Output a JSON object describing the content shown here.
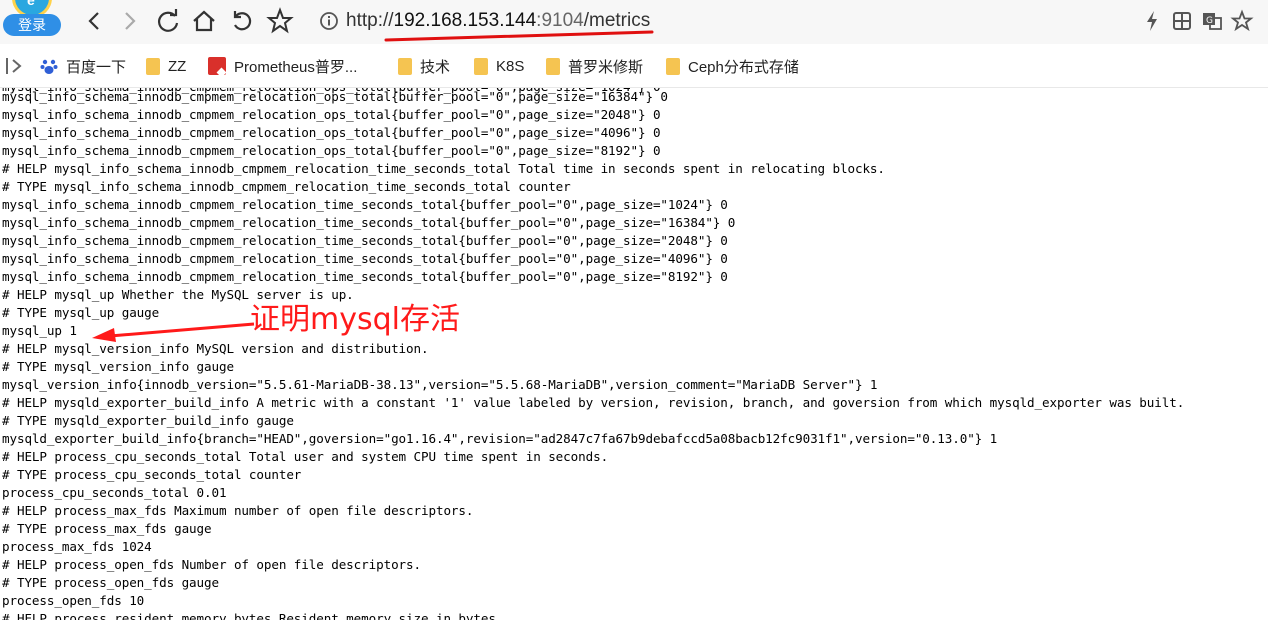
{
  "toolbar": {
    "login_label": "登录",
    "url": {
      "protocol": "http://",
      "host": "192.168.153.144",
      "port": ":9104",
      "path": "/metrics"
    },
    "icons": [
      "back-icon",
      "forward-icon",
      "reload-icon",
      "home-icon",
      "undo-icon",
      "star-icon",
      "info-icon",
      "lightning-icon",
      "grid-icon",
      "translate-icon",
      "favorite-star-icon"
    ]
  },
  "bookmarks": [
    {
      "label": "百度一下",
      "icon": "baidu-paw-icon"
    },
    {
      "label": "ZZ",
      "icon": "folder-icon"
    },
    {
      "label": "Prometheus普罗...",
      "icon": "pdf-icon"
    },
    {
      "label": "技术",
      "icon": "folder-icon"
    },
    {
      "label": "K8S",
      "icon": "folder-icon"
    },
    {
      "label": "普罗米修斯",
      "icon": "folder-icon"
    },
    {
      "label": "Ceph分布式存储",
      "icon": "folder-icon"
    }
  ],
  "content": {
    "lines": [
      "mysql_info_schema_innodb_cmpmem_relocation_ops_total{buffer_pool=\"0\",page_size=\"16384\"} 0",
      "mysql_info_schema_innodb_cmpmem_relocation_ops_total{buffer_pool=\"0\",page_size=\"2048\"} 0",
      "mysql_info_schema_innodb_cmpmem_relocation_ops_total{buffer_pool=\"0\",page_size=\"4096\"} 0",
      "mysql_info_schema_innodb_cmpmem_relocation_ops_total{buffer_pool=\"0\",page_size=\"8192\"} 0",
      "# HELP mysql_info_schema_innodb_cmpmem_relocation_time_seconds_total Total time in seconds spent in relocating blocks.",
      "# TYPE mysql_info_schema_innodb_cmpmem_relocation_time_seconds_total counter",
      "mysql_info_schema_innodb_cmpmem_relocation_time_seconds_total{buffer_pool=\"0\",page_size=\"1024\"} 0",
      "mysql_info_schema_innodb_cmpmem_relocation_time_seconds_total{buffer_pool=\"0\",page_size=\"16384\"} 0",
      "mysql_info_schema_innodb_cmpmem_relocation_time_seconds_total{buffer_pool=\"0\",page_size=\"2048\"} 0",
      "mysql_info_schema_innodb_cmpmem_relocation_time_seconds_total{buffer_pool=\"0\",page_size=\"4096\"} 0",
      "mysql_info_schema_innodb_cmpmem_relocation_time_seconds_total{buffer_pool=\"0\",page_size=\"8192\"} 0",
      "# HELP mysql_up Whether the MySQL server is up.",
      "# TYPE mysql_up gauge",
      "mysql_up 1",
      "# HELP mysql_version_info MySQL version and distribution.",
      "# TYPE mysql_version_info gauge",
      "mysql_version_info{innodb_version=\"5.5.61-MariaDB-38.13\",version=\"5.5.68-MariaDB\",version_comment=\"MariaDB Server\"} 1",
      "# HELP mysqld_exporter_build_info A metric with a constant '1' value labeled by version, revision, branch, and goversion from which mysqld_exporter was built.",
      "# TYPE mysqld_exporter_build_info gauge",
      "mysqld_exporter_build_info{branch=\"HEAD\",goversion=\"go1.16.4\",revision=\"ad2847c7fa67b9debafccd5a08bacb12fc9031f1\",version=\"0.13.0\"} 1",
      "# HELP process_cpu_seconds_total Total user and system CPU time spent in seconds.",
      "# TYPE process_cpu_seconds_total counter",
      "process_cpu_seconds_total 0.01",
      "# HELP process_max_fds Maximum number of open file descriptors.",
      "# TYPE process_max_fds gauge",
      "process_max_fds 1024",
      "# HELP process_open_fds Number of open file descriptors.",
      "# TYPE process_open_fds gauge",
      "process_open_fds 10",
      "# HELP process_resident_memory_bytes Resident memory size in bytes."
    ]
  },
  "annotation": {
    "text": "证明mysql存活",
    "color": "#ff1a1a"
  },
  "colors": {
    "toolbar_bg": "#f7f7f7",
    "annotation_red": "#ff1a1a",
    "folder_yellow": "#f5c451"
  }
}
